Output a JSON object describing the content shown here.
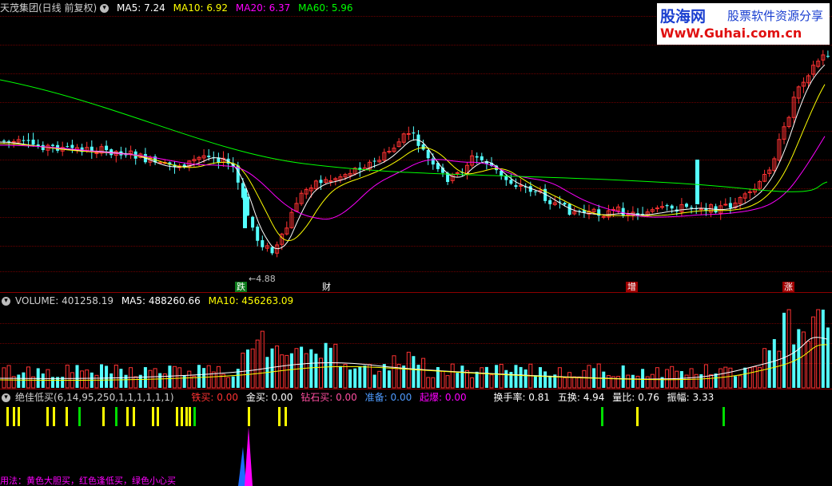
{
  "price_panel": {
    "stock_title": "天茂集团(日线 前复权)",
    "ma5": "MA5: 7.24",
    "ma10": "MA10: 6.92",
    "ma20": "MA20: 6.37",
    "ma60": "MA60: 5.96",
    "low_label": "4.88",
    "events": [
      "跌",
      "财",
      "增",
      "涨"
    ]
  },
  "volume_panel": {
    "volume": "VOLUME: 401258.19",
    "ma5": "MA5: 488260.66",
    "ma10": "MA10: 456263.09"
  },
  "indicator_panel": {
    "name": "绝佳低买(6,14,95,250,1,1,1,1,1,1)",
    "iron_buy": "铁买: 0.00",
    "gold_buy": "金买: 0.00",
    "diamond_buy": "钻石买: 0.00",
    "prepare": "准备: 0.00",
    "takeoff": "起爆: 0.00",
    "turnover": "换手率: 0.81",
    "five_turnover": "五换: 4.94",
    "volume_ratio": "量比: 0.76",
    "amplitude": "振幅: 3.33",
    "usage": "用法：黄色大胆买，红色逢低买，绿色小心买"
  },
  "watermark": {
    "brand": "股海网",
    "slogan": "股票软件资源分享",
    "url": "WwW.Guhai.com.cn"
  },
  "colors": {
    "background": "#000000",
    "up": "#ff3232",
    "down": "#54ffff",
    "ma5": "#ffffff",
    "ma10": "#ffff00",
    "ma20": "#ff00ff",
    "ma60": "#00ff00",
    "signal_yellow": "#ffff00",
    "signal_green": "#00dd00",
    "spike_pink": "#ff00ff",
    "spike_blue": "#1e6bff"
  }
}
